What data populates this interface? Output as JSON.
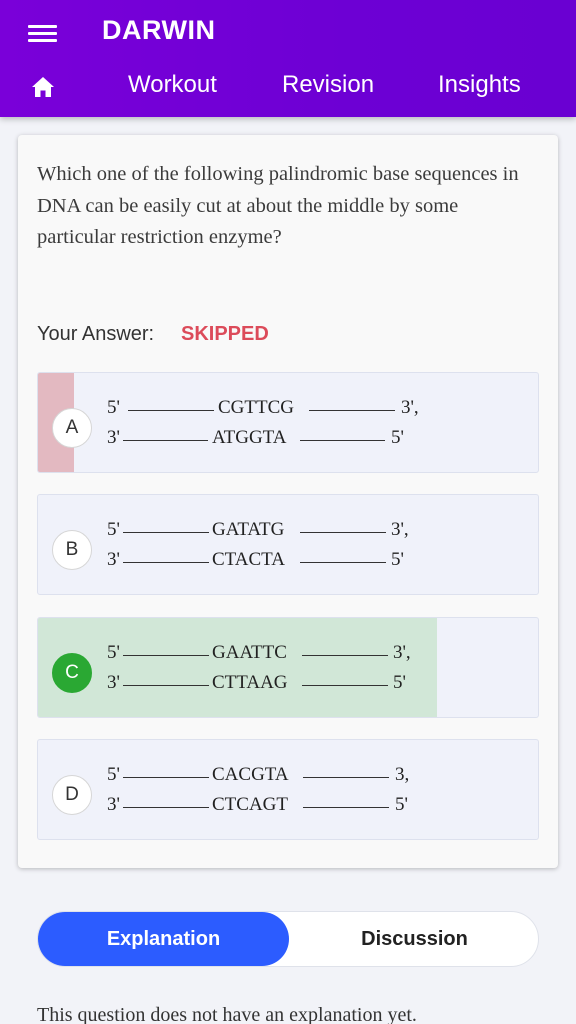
{
  "app": {
    "title": "DARWIN",
    "nav": [
      "Workout",
      "Revision",
      "Insights"
    ]
  },
  "question": {
    "text": "Which one of the following palindromic base sequences in DNA can be easily cut at about the middle by some particular restriction enzyme?",
    "your_answer_label": "Your Answer:",
    "your_answer_value": "SKIPPED"
  },
  "options": [
    {
      "letter": "A",
      "top": [
        "5'",
        "CGTTCG",
        "3',"
      ],
      "bottom": [
        "3'",
        "ATGGTA",
        "5'"
      ],
      "state": "marked"
    },
    {
      "letter": "B",
      "top": [
        "5'",
        "GATATG",
        "3',"
      ],
      "bottom": [
        "3'",
        "CTACTA",
        "5'"
      ],
      "state": "none"
    },
    {
      "letter": "C",
      "top": [
        "5'",
        "GAATTC",
        "3',"
      ],
      "bottom": [
        "3'",
        "CTTAAG",
        "5'"
      ],
      "state": "correct"
    },
    {
      "letter": "D",
      "top": [
        "5'",
        "CACGTA",
        "3,"
      ],
      "bottom": [
        "3'",
        "CTCAGT",
        "5'"
      ],
      "state": "none"
    }
  ],
  "tabs": {
    "active": "Explanation",
    "inactive": "Discussion"
  },
  "explanation": {
    "text": "This question does not have an explanation yet."
  },
  "colors": {
    "header": "#7000d6",
    "skipped": "#dc4b5a",
    "correct": "#2aa833",
    "tab_active": "#2c5cff"
  }
}
